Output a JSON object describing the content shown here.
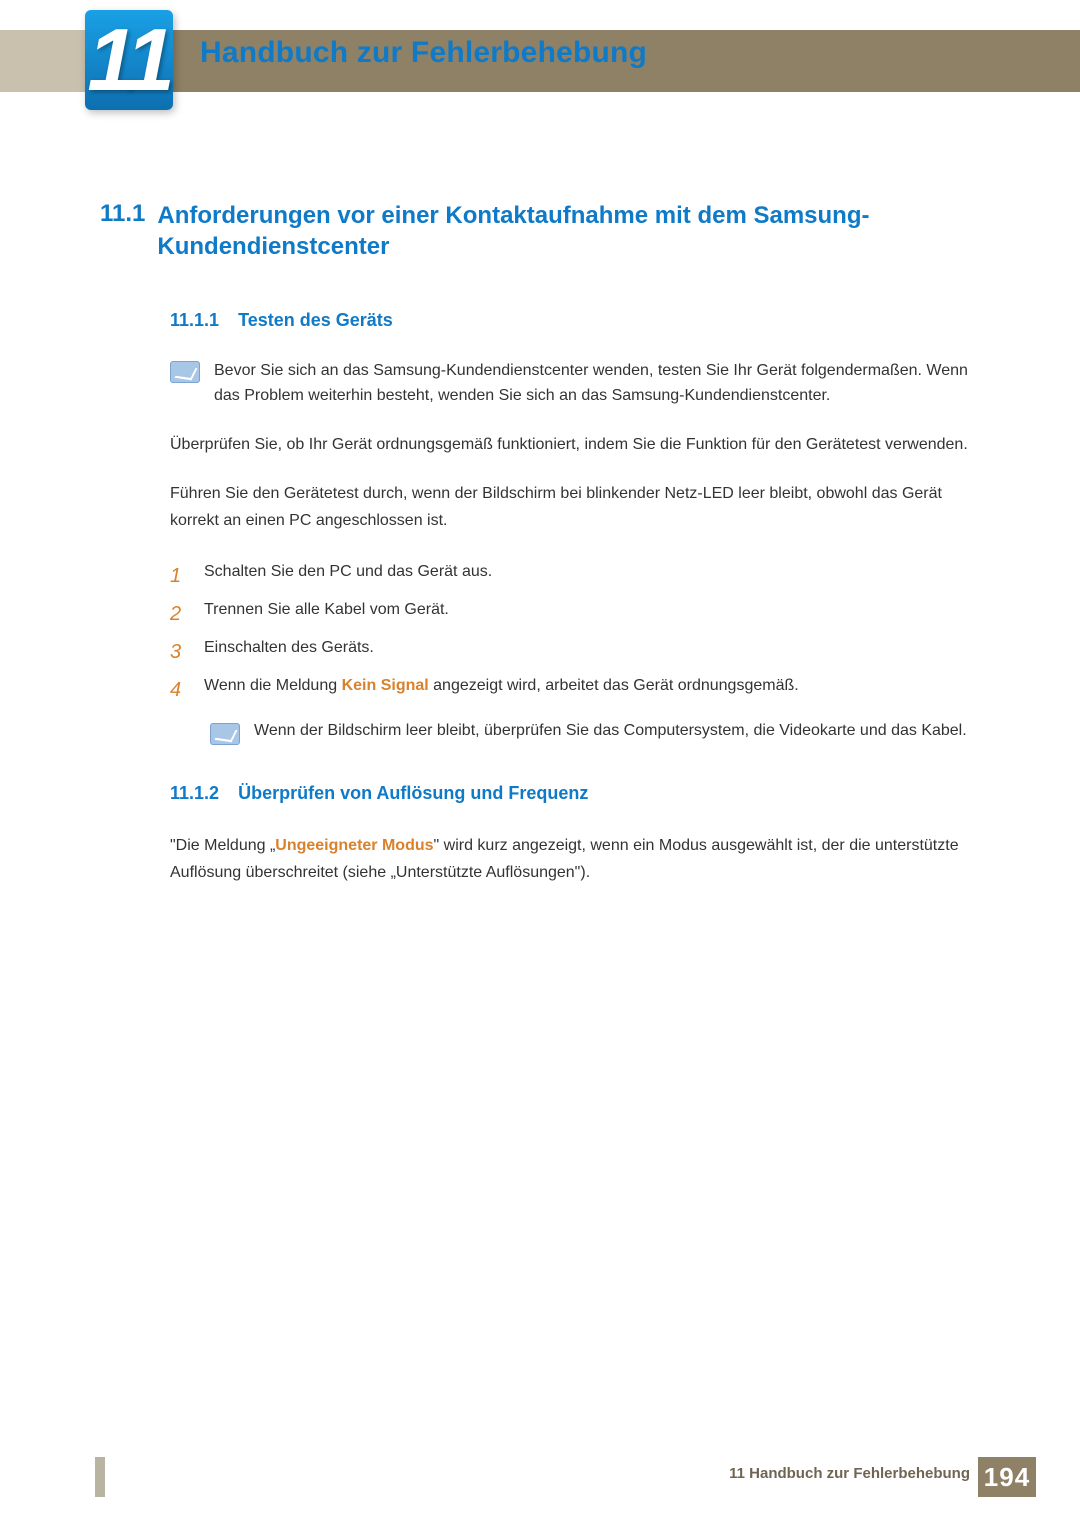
{
  "chapter": {
    "number": "11",
    "title": "Handbuch zur Fehlerbehebung"
  },
  "section": {
    "number": "11.1",
    "title": "Anforderungen vor einer Kontaktaufnahme mit dem Samsung-Kundendienstcenter"
  },
  "sub1": {
    "number": "11.1.1",
    "title": "Testen des Geräts",
    "note": "Bevor Sie sich an das Samsung-Kundendienstcenter wenden, testen Sie Ihr Gerät folgendermaßen. Wenn das Problem weiterhin besteht, wenden Sie sich an das Samsung-Kundendienstcenter.",
    "para1": "Überprüfen Sie, ob Ihr Gerät ordnungsgemäß funktioniert, indem Sie die Funktion für den Gerätetest verwenden.",
    "para2": "Führen Sie den Gerätetest durch, wenn der Bildschirm bei blinkender Netz-LED leer bleibt, obwohl das Gerät korrekt an einen PC angeschlossen ist.",
    "steps": [
      {
        "n": "1",
        "t": "Schalten Sie den PC und das Gerät aus."
      },
      {
        "n": "2",
        "t": "Trennen Sie alle Kabel vom Gerät."
      },
      {
        "n": "3",
        "t": "Einschalten des Geräts."
      },
      {
        "n": "4",
        "t_pre": "Wenn die Meldung ",
        "hl": "Kein Signal",
        "t_post": " angezeigt wird, arbeitet das Gerät ordnungsgemäß."
      }
    ],
    "step_note": "Wenn der Bildschirm leer bleibt, überprüfen Sie das Computersystem, die Videokarte und das Kabel."
  },
  "sub2": {
    "number": "11.1.2",
    "title": "Überprüfen von Auflösung und Frequenz",
    "para_pre": "\"Die Meldung „",
    "para_hl": "Ungeeigneter Modus",
    "para_post": "\" wird kurz angezeigt, wenn ein Modus ausgewählt ist, der die unterstützte Auflösung überschreitet (siehe „Unterstützte Auflösungen\")."
  },
  "footer": {
    "text": "11 Handbuch zur Fehlerbehebung",
    "page": "194"
  }
}
